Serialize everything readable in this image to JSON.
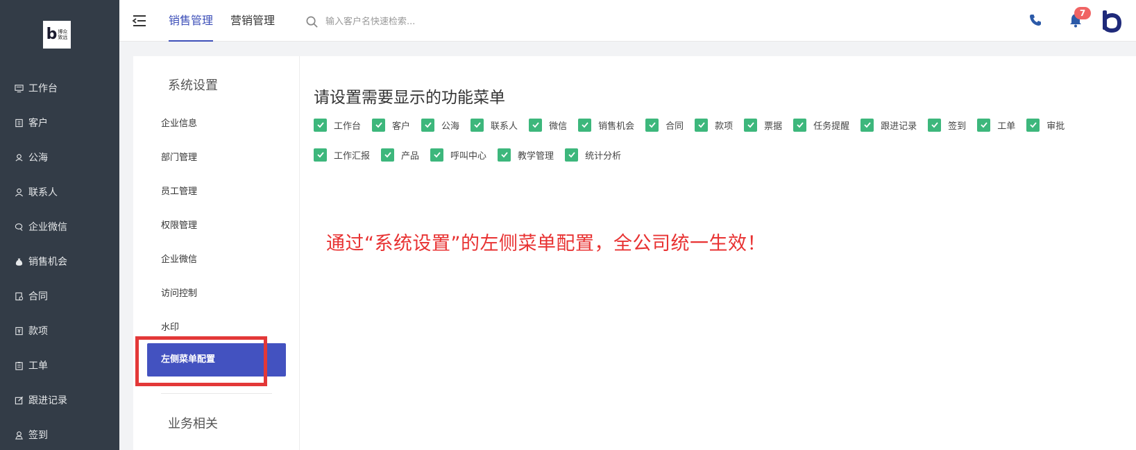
{
  "logo": {
    "line1": "博众",
    "line2": "致远",
    "letter": "b"
  },
  "sidebar": {
    "items": [
      {
        "label": "工作台",
        "icon": "monitor-icon"
      },
      {
        "label": "客户",
        "icon": "building-icon"
      },
      {
        "label": "公海",
        "icon": "sea-icon"
      },
      {
        "label": "联系人",
        "icon": "user-icon"
      },
      {
        "label": "企业微信",
        "icon": "chat-icon"
      },
      {
        "label": "销售机会",
        "icon": "money-bag-icon"
      },
      {
        "label": "合同",
        "icon": "contract-icon"
      },
      {
        "label": "款项",
        "icon": "payment-icon"
      },
      {
        "label": "工单",
        "icon": "clipboard-icon"
      },
      {
        "label": "跟进记录",
        "icon": "edit-icon"
      },
      {
        "label": "签到",
        "icon": "location-icon"
      }
    ]
  },
  "header": {
    "tabs": [
      "销售管理",
      "营销管理"
    ],
    "active_tab": "销售管理",
    "search_placeholder": "输入客户名快速检索...",
    "notification_count": "7",
    "accent": "#3d4fb8"
  },
  "settings": {
    "section1_title": "系统设置",
    "items": [
      "企业信息",
      "部门管理",
      "员工管理",
      "权限管理",
      "企业微信",
      "访问控制",
      "水印"
    ],
    "active_item": "左侧菜单配置",
    "section2_title": "业务相关"
  },
  "main": {
    "title": "请设置需要显示的功能菜单",
    "row1": [
      "工作台",
      "客户",
      "公海",
      "联系人",
      "微信",
      "销售机会",
      "合同",
      "款项",
      "票据",
      "任务提醒",
      "跟进记录",
      "签到",
      "工单",
      "审批"
    ],
    "row2": [
      "工作汇报",
      "产品",
      "呼叫中心",
      "教学管理",
      "统计分析"
    ],
    "annotation": "通过“系统设置”的左侧菜单配置，全公司统一生效！",
    "check_color": "#3db77c",
    "annotation_color": "#e83232"
  }
}
